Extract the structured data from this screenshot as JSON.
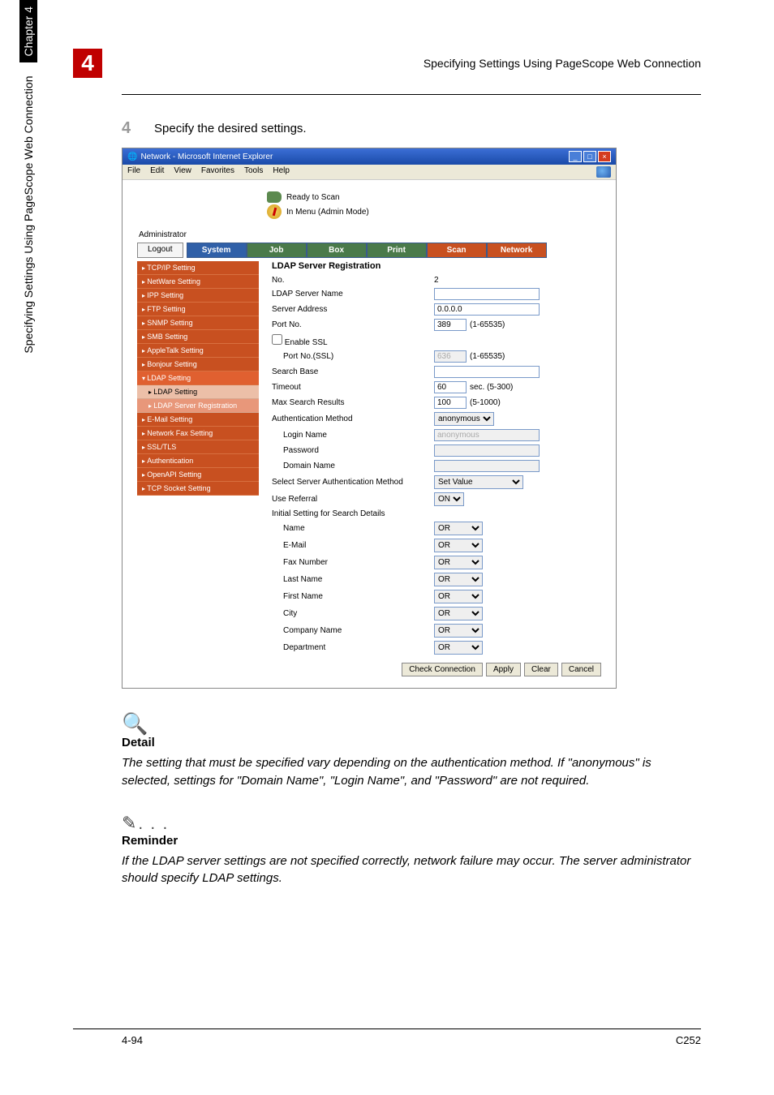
{
  "header": {
    "chapter_num": "4",
    "title": "Specifying Settings Using PageScope Web Connection"
  },
  "step": {
    "num": "4",
    "text": "Specify the desired settings."
  },
  "ie": {
    "title": "Network - Microsoft Internet Explorer",
    "menu": {
      "file": "File",
      "edit": "Edit",
      "view": "View",
      "favorites": "Favorites",
      "tools": "Tools",
      "help": "Help"
    },
    "status": {
      "ready": "Ready to Scan",
      "menu_mode": "In Menu (Admin Mode)"
    },
    "admin_label": "Administrator",
    "logout": "Logout",
    "tabs": {
      "system": "System",
      "job": "Job",
      "box": "Box",
      "print": "Print",
      "scan": "Scan",
      "network": "Network"
    }
  },
  "sidebar": {
    "tcpip": "TCP/IP Setting",
    "netware": "NetWare Setting",
    "ipp": "IPP Setting",
    "ftp": "FTP Setting",
    "snmp": "SNMP Setting",
    "smb": "SMB Setting",
    "appletalk": "AppleTalk Setting",
    "bonjour": "Bonjour Setting",
    "ldap": "LDAP Setting",
    "ldap_sub": "LDAP Setting",
    "ldap_reg": "LDAP Server Registration",
    "email": "E-Mail Setting",
    "netfax": "Network Fax Setting",
    "ssl": "SSL/TLS",
    "auth": "Authentication",
    "openapi": "OpenAPI Setting",
    "tcpsock": "TCP Socket Setting"
  },
  "form": {
    "title": "LDAP Server Registration",
    "rows": {
      "no": "No.",
      "no_val": "2",
      "server_name": "LDAP Server Name",
      "server_name_val": "",
      "server_addr": "Server Address",
      "server_addr_val": "0.0.0.0",
      "port_no": "Port No.",
      "port_no_val": "389",
      "port_no_range": "(1-65535)",
      "enable_ssl": "Enable SSL",
      "port_no_ssl": "Port No.(SSL)",
      "port_no_ssl_val": "636",
      "port_no_ssl_range": "(1-65535)",
      "search_base": "Search Base",
      "search_base_val": "",
      "timeout": "Timeout",
      "timeout_val": "60",
      "timeout_suffix": "sec. (5-300)",
      "max_results": "Max Search Results",
      "max_results_val": "100",
      "max_results_suffix": "(5-1000)",
      "auth_method": "Authentication Method",
      "auth_method_val": "anonymous",
      "login_name": "Login Name",
      "login_name_val": "anonymous",
      "password": "Password",
      "password_val": "",
      "domain_name": "Domain Name",
      "domain_name_val": "",
      "sel_server_auth": "Select Server Authentication Method",
      "sel_server_auth_val": "Set Value",
      "use_referral": "Use Referral",
      "use_referral_val": "ON",
      "initial_settings": "Initial Setting for Search Details",
      "d_name": "Name",
      "d_name_val": "OR",
      "d_email": "E-Mail",
      "d_email_val": "OR",
      "d_fax": "Fax Number",
      "d_fax_val": "OR",
      "d_lname": "Last Name",
      "d_lname_val": "OR",
      "d_fname": "First Name",
      "d_fname_val": "OR",
      "d_city": "City",
      "d_city_val": "OR",
      "d_company": "Company Name",
      "d_company_val": "OR",
      "d_dept": "Department",
      "d_dept_val": "OR"
    },
    "buttons": {
      "check": "Check Connection",
      "apply": "Apply",
      "clear": "Clear",
      "cancel": "Cancel"
    }
  },
  "detail": {
    "heading": "Detail",
    "body": "The setting that must be specified vary depending on the authentication method. If \"anonymous\" is selected, settings for \"Domain Name\", \"Login Name\", and \"Password\" are not required."
  },
  "reminder": {
    "heading": "Reminder",
    "body": "If the LDAP server settings are not specified correctly, network failure may occur. The server administrator should specify LDAP settings."
  },
  "vertical": {
    "section": "Specifying Settings Using PageScope Web Connection",
    "chapter": "Chapter 4"
  },
  "footer": {
    "page": "4-94",
    "model": "C252"
  }
}
